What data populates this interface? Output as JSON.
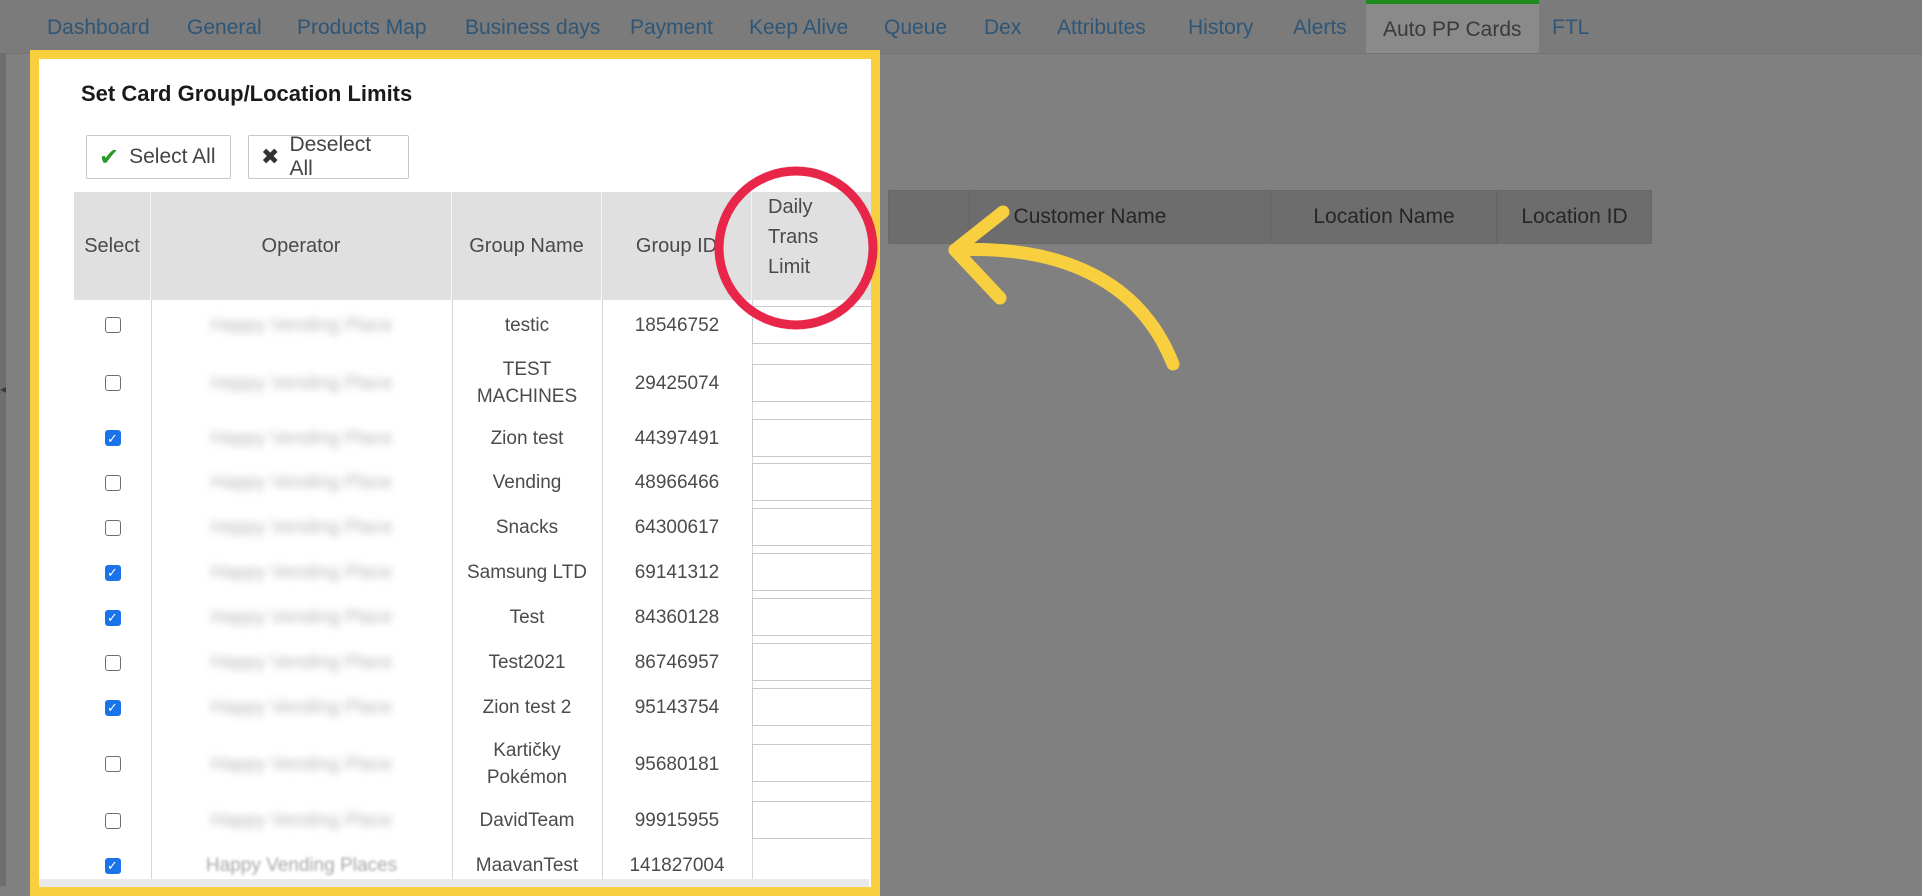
{
  "tabs": [
    {
      "label": "Dashboard"
    },
    {
      "label": "General"
    },
    {
      "label": "Products Map"
    },
    {
      "label": "Business days"
    },
    {
      "label": "Payment"
    },
    {
      "label": "Keep Alive"
    },
    {
      "label": "Queue"
    },
    {
      "label": "Dex"
    },
    {
      "label": "Attributes"
    },
    {
      "label": "History"
    },
    {
      "label": "Alerts"
    },
    {
      "label": "Auto PP Cards"
    },
    {
      "label": "FTL"
    }
  ],
  "active_tab": "Auto PP Cards",
  "background_table": {
    "columns": [
      "Customer Name",
      "Location Name",
      "Location ID"
    ]
  },
  "modal": {
    "title": "Set Card Group/Location Limits",
    "select_all_label": "Select All",
    "deselect_all_label": "Deselect All",
    "columns": {
      "select": "Select",
      "operator": "Operator",
      "group_name": "Group Name",
      "group_id": "Group ID",
      "limit_line1": "Daily",
      "limit_line2": "Trans",
      "limit_line3": "Limit"
    },
    "rows": [
      {
        "checked": false,
        "operator": "Happy Vending Place",
        "group_name": "testic",
        "group_id": "18546752",
        "limit": ""
      },
      {
        "checked": false,
        "operator": "Happy Vending Place",
        "group_name_1": "TEST",
        "group_name_2": "MACHINES",
        "group_id": "29425074",
        "limit": ""
      },
      {
        "checked": true,
        "operator": "Happy Vending Place",
        "group_name": "Zion test",
        "group_id": "44397491",
        "limit": ""
      },
      {
        "checked": false,
        "operator": "Happy Vending Place",
        "group_name": "Vending",
        "group_id": "48966466",
        "limit": ""
      },
      {
        "checked": false,
        "operator": "Happy Vending Place",
        "group_name": "Snacks",
        "group_id": "64300617",
        "limit": ""
      },
      {
        "checked": true,
        "operator": "Happy Vending Place",
        "group_name": "Samsung LTD",
        "group_id": "69141312",
        "limit": ""
      },
      {
        "checked": true,
        "operator": "Happy Vending Place",
        "group_name": "Test",
        "group_id": "84360128",
        "limit": ""
      },
      {
        "checked": false,
        "operator": "Happy Vending Place",
        "group_name": "Test2021",
        "group_id": "86746957",
        "limit": ""
      },
      {
        "checked": true,
        "operator": "Happy Vending Place",
        "group_name": "Zion test 2",
        "group_id": "95143754",
        "limit": ""
      },
      {
        "checked": false,
        "operator": "Happy Vending Place",
        "group_name_1": "Kartičky",
        "group_name_2": "Pokémon",
        "group_id": "95680181",
        "limit": ""
      },
      {
        "checked": false,
        "operator": "Happy Vending Place",
        "group_name": "DavidTeam",
        "group_id": "99915955",
        "limit": ""
      },
      {
        "checked": true,
        "operator": "Happy Vending Places",
        "group_name": "MaavanTest",
        "group_id": "141827004",
        "limit": ""
      }
    ]
  },
  "colors": {
    "highlight_border": "#f8cf3f",
    "annotation_circle": "#e8264a",
    "annotation_arrow": "#f8cf3f",
    "active_tab_accent": "#1e8a1e",
    "checkbox_checked": "#1a73e8"
  }
}
